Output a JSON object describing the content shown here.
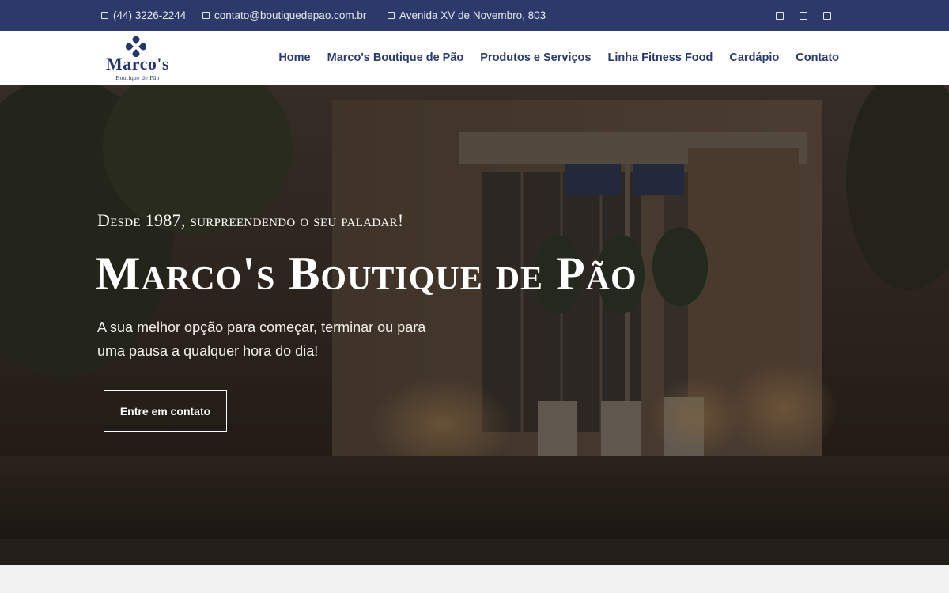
{
  "topbar": {
    "phone": "(44) 3226-2244",
    "email": "contato@boutiquedepao.com.br",
    "address": "Avenida XV de Novembro, 803",
    "phone_icon": "phone-icon",
    "email_icon": "envelope-icon",
    "address_icon": "map-marker-icon",
    "social_icons": [
      "facebook-icon",
      "instagram-icon",
      "whatsapp-icon"
    ]
  },
  "brand": {
    "name": "Marco's",
    "tagline": "Boutique de Pão"
  },
  "nav": {
    "items": [
      {
        "label": "Home"
      },
      {
        "label": "Marco's Boutique de Pão"
      },
      {
        "label": "Produtos e Serviços"
      },
      {
        "label": "Linha Fitness Food"
      },
      {
        "label": "Cardápio"
      },
      {
        "label": "Contato"
      }
    ]
  },
  "hero": {
    "eyebrow": "Desde 1987, surpreendendo o seu paladar!",
    "title": "Marco's Boutique de Pão",
    "subtitle": "A sua melhor opção para começar, terminar ou para uma pausa a qualquer hora do dia!",
    "cta_label": "Entre em contato"
  },
  "colors": {
    "topbar_bg": "#2b3a6b",
    "brand_navy": "#26356a",
    "nav_text": "#2b3a6b",
    "hero_text": "#ffffff"
  }
}
